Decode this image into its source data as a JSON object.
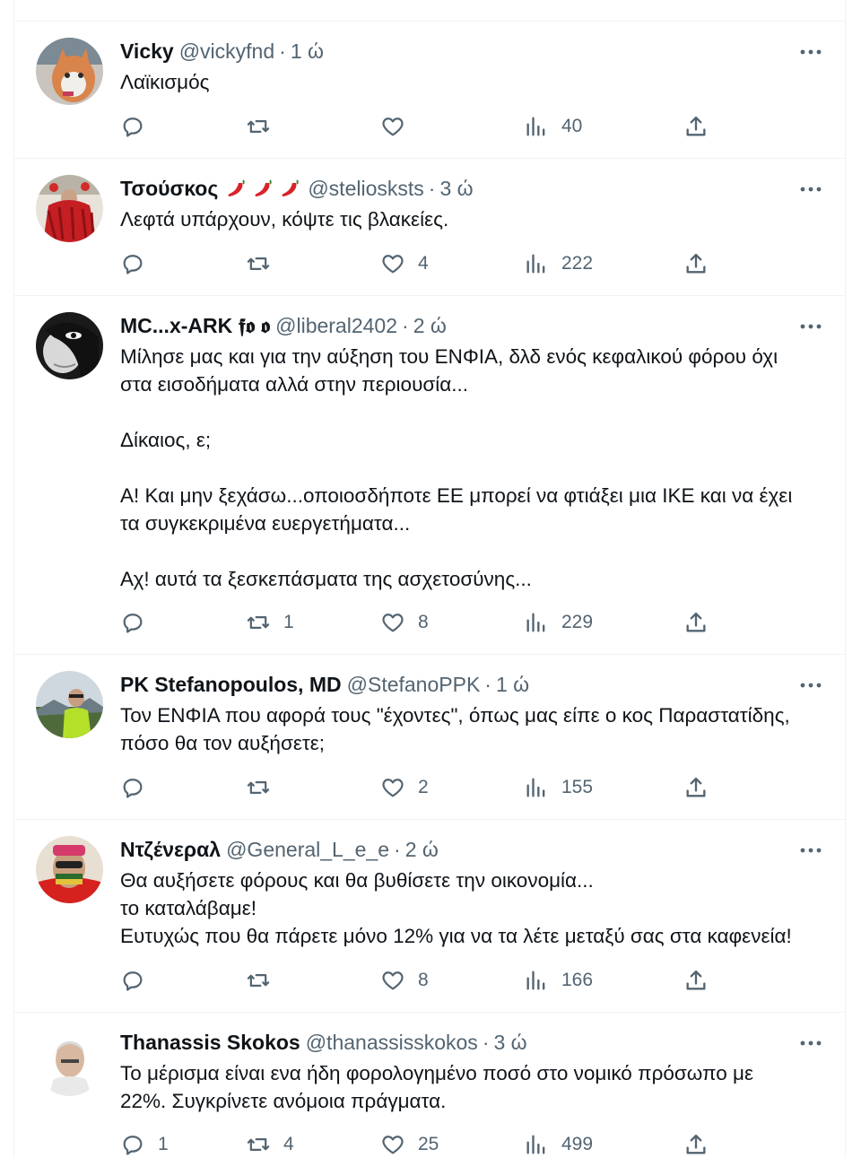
{
  "tweets": [
    {
      "name": "Vicky",
      "handle": "@vickyfnd",
      "time": "1 ώ",
      "lines": [
        "Λαϊκισμός"
      ],
      "replies": "",
      "retweets": "",
      "likes": "",
      "views": "40",
      "emoji": []
    },
    {
      "name": "Τσούσκος",
      "handle": "@steliosksts",
      "time": "3 ώ",
      "lines": [
        "Λεφτά υπάρχουν, κόψτε τις βλακείες."
      ],
      "replies": "",
      "retweets": "",
      "likes": "4",
      "views": "222",
      "emoji": [
        "chili-pepper",
        "chili-pepper",
        "chili-pepper"
      ]
    },
    {
      "name": "MC...x-ARK 𝖋𝖔 𝖔",
      "handle": "@liberal2402",
      "time": "2 ώ",
      "lines": [
        "Μίλησε μας και για την αύξηση του ΕΝΦΙΑ, δλδ ενός κεφαλικού φόρου όχι",
        "στα εισοδήματα αλλά στην περιουσία...",
        "",
        "Δίκαιος, ε;",
        "",
        "Α! Και μην ξεχάσω...οποιοσδήποτε ΕΕ μπορεί να φτιάξει μια ΙΚΕ και να έχει",
        "τα συγκεκριμένα ευεργετήματα...",
        "",
        "Αχ! αυτά τα ξεσκεπάσματα της ασχετοσύνης..."
      ],
      "replies": "",
      "retweets": "1",
      "likes": "8",
      "views": "229",
      "emoji": []
    },
    {
      "name": "PK Stefanopoulos, MD",
      "handle": "@StefanoPPK",
      "time": "1 ώ",
      "lines": [
        "Τον ΕΝΦΙΑ που αφορά τους \"έχοντες\", όπως μας είπε ο κος Παραστατίδης,",
        "πόσο θα τον αυξήσετε;"
      ],
      "replies": "",
      "retweets": "",
      "likes": "2",
      "views": "155",
      "emoji": []
    },
    {
      "name": "Ντζένεραλ",
      "handle": "@General_L_e_e",
      "time": "2 ώ",
      "lines": [
        "Θα αυξήσετε φόρους και θα βυθίσετε την οικονομία...",
        "το καταλάβαμε!",
        "Ευτυχώς που θα πάρετε μόνο 12% για να τα λέτε μεταξύ σας στα καφενεία!"
      ],
      "replies": "",
      "retweets": "",
      "likes": "8",
      "views": "166",
      "emoji": []
    },
    {
      "name": "Thanassis Skokos",
      "handle": "@thanassisskokos",
      "time": "3 ώ",
      "lines": [
        "Το μέρισμα είναι ενα ήδη φορολογημένο ποσό στο νομικό πρόσωπο με",
        "22%. Συγκρίνετε ανόμοια πράγματα."
      ],
      "replies": "1",
      "retweets": "4",
      "likes": "25",
      "views": "499",
      "emoji": []
    }
  ],
  "icons": {
    "reply": "reply-icon",
    "retweet": "retweet-icon",
    "like": "heart-icon",
    "views": "views-icon",
    "share": "share-icon",
    "more": "more-icon"
  },
  "colors": {
    "text": "#0f1419",
    "muted": "#536471",
    "border": "#eff3f4"
  }
}
